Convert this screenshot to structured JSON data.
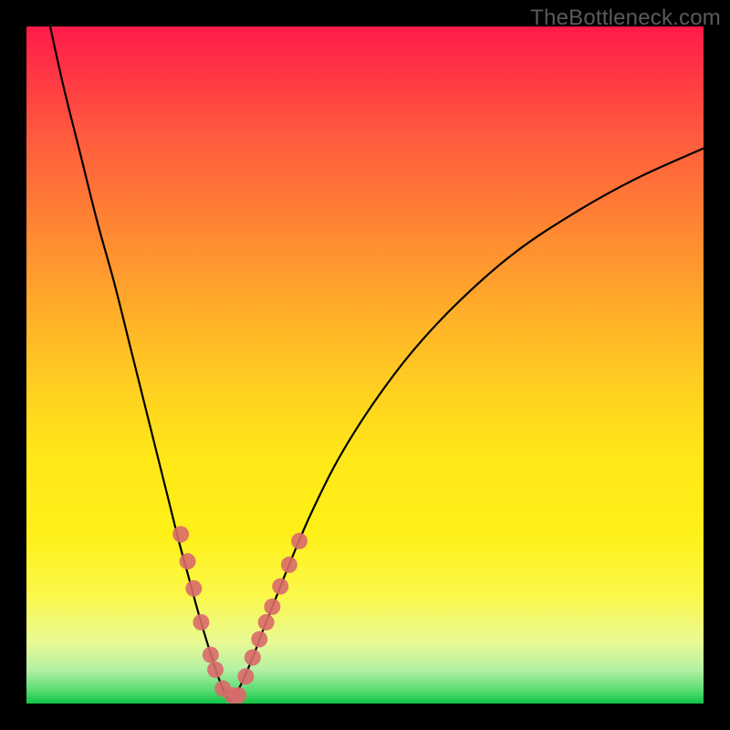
{
  "watermark": "TheBottleneck.com",
  "chart_data": {
    "type": "line",
    "title": "",
    "xlabel": "",
    "ylabel": "",
    "xlim": [
      0,
      100
    ],
    "ylim": [
      0,
      100
    ],
    "grid": false,
    "legend": false,
    "background_gradient": {
      "top": "#ff1a49",
      "middle": "#ffe818",
      "bottom": "#0fc445",
      "meaning": "red = high bottleneck percentage, green = low/zero bottleneck"
    },
    "series": [
      {
        "name": "left-branch",
        "stroke": "#000000",
        "x": [
          3.5,
          5.5,
          8.0,
          10.5,
          13.0,
          15.5,
          17.5,
          19.5,
          21.0,
          22.5,
          24.0,
          25.5,
          27.0,
          28.3,
          29.3,
          30.0
        ],
        "y": [
          100,
          91,
          81,
          71,
          62,
          52,
          44,
          36,
          30,
          24,
          18.5,
          13,
          8.0,
          4.0,
          1.5,
          0.3
        ]
      },
      {
        "name": "right-branch",
        "stroke": "#000000",
        "x": [
          30.0,
          31.0,
          32.0,
          33.5,
          35.0,
          37.0,
          39.0,
          42.0,
          46.0,
          51.0,
          57.0,
          64.0,
          72.0,
          81.0,
          90.0,
          100.0
        ],
        "y": [
          0.3,
          1.5,
          3.5,
          7.0,
          11.0,
          16.0,
          21.0,
          28.0,
          36.0,
          44.0,
          52.0,
          59.5,
          66.5,
          72.5,
          77.5,
          82.0
        ]
      }
    ],
    "dots": {
      "name": "highlighted-points",
      "color": "#d96a6a",
      "radius_px": 9,
      "x": [
        22.8,
        23.8,
        24.7,
        25.8,
        27.2,
        27.9,
        29.0,
        30.4,
        31.3,
        32.4,
        33.4,
        34.4,
        35.4,
        36.3,
        37.5,
        38.8,
        40.3
      ],
      "y": [
        25.0,
        21.0,
        17.0,
        12.0,
        7.2,
        5.0,
        2.2,
        1.2,
        1.2,
        4.0,
        6.8,
        9.5,
        12.0,
        14.3,
        17.3,
        20.5,
        24.0
      ]
    },
    "minimum_x": 30.0,
    "annotation": "V-shaped bottleneck curve; minimum (0%) near x≈30; curve rises steeply for x<30 and asymptotically for x>30"
  }
}
